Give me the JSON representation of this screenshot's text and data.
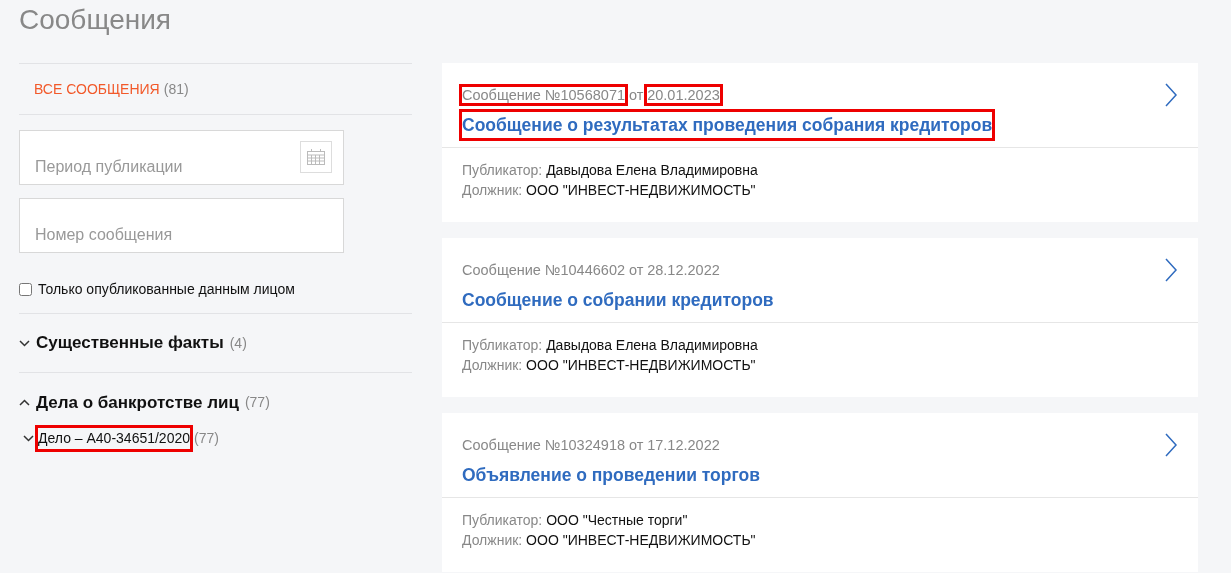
{
  "page_title": "Сообщения",
  "sidebar": {
    "all_messages": {
      "label": "ВСЕ СООБЩЕНИЯ",
      "count": "(81)",
      "selected": true
    },
    "period_field": {
      "placeholder": "Период публикации"
    },
    "number_field": {
      "placeholder": "Номер сообщения"
    },
    "only_own": {
      "label": "Только опубликованные данным лицом",
      "checked": false
    },
    "groups": [
      {
        "label": "Существенные факты",
        "count": "(4)",
        "expanded": false
      },
      {
        "label": "Дела о банкротстве лиц",
        "count": "(77)",
        "expanded": true,
        "children": [
          {
            "label": "Дело – А40-34651/2020",
            "count": "(77)",
            "expanded": false,
            "highlighted": true
          }
        ]
      }
    ]
  },
  "messages": [
    {
      "number": "Сообщение №10568071",
      "from": "от",
      "date": "20.01.2023",
      "title": "Сообщение о результатах проведения собрания кредиторов",
      "publisher_label": "Публикатор:",
      "publisher": "Давыдова Елена Владимировна",
      "debtor_label": "Должник:",
      "debtor": "ООО \"ИНВЕСТ-НЕДВИЖИМОСТЬ\"",
      "number_highlighted": true,
      "date_highlighted": true,
      "title_highlighted": true
    },
    {
      "number": "Сообщение №10446602",
      "from": "от",
      "date": "28.12.2022",
      "title": "Сообщение о собрании кредиторов",
      "publisher_label": "Публикатор:",
      "publisher": "Давыдова Елена Владимировна",
      "debtor_label": "Должник:",
      "debtor": "ООО \"ИНВЕСТ-НЕДВИЖИМОСТЬ\"",
      "number_highlighted": false,
      "date_highlighted": false,
      "title_highlighted": false
    },
    {
      "number": "Сообщение №10324918",
      "from": "от",
      "date": "17.12.2022",
      "title": "Объявление о проведении торгов",
      "publisher_label": "Публикатор:",
      "publisher": "ООО \"Честные торги\"",
      "debtor_label": "Должник:",
      "debtor": "ООО \"ИНВЕСТ-НЕДВИЖИМОСТЬ\"",
      "number_highlighted": false,
      "date_highlighted": false,
      "title_highlighted": false
    }
  ]
}
